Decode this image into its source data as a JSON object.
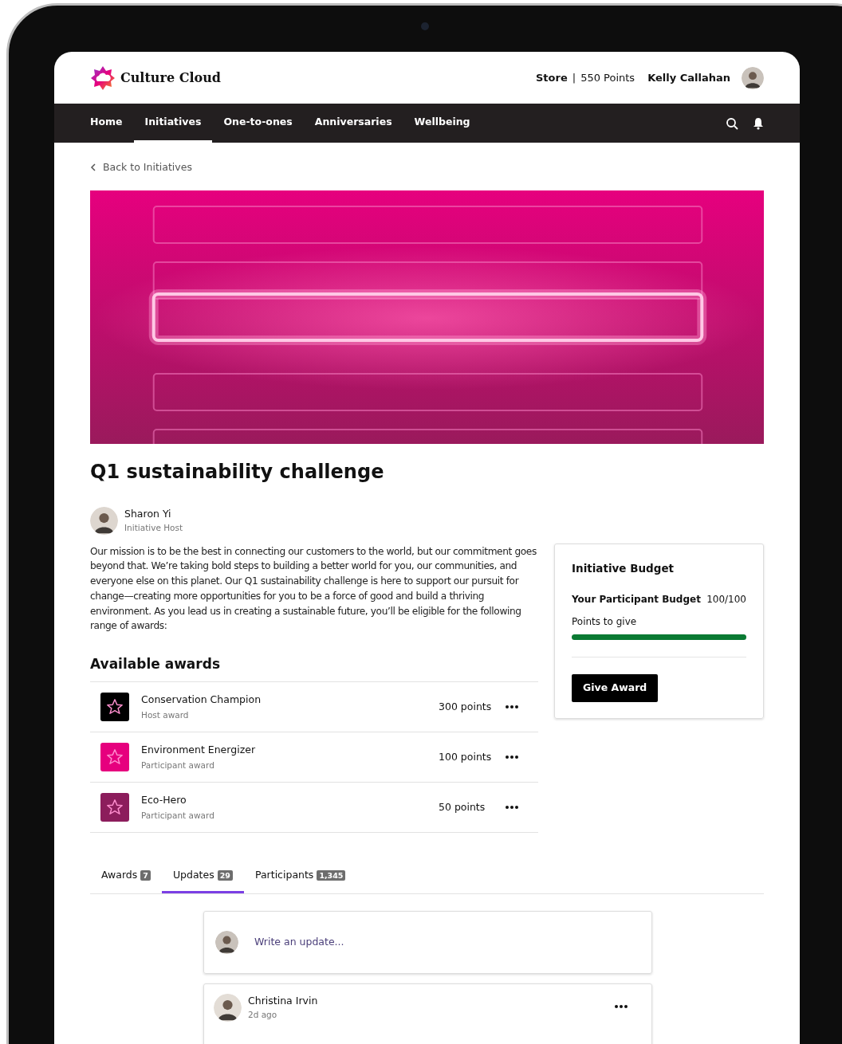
{
  "header": {
    "brand": "Culture Cloud",
    "store": "Store",
    "separator": "|",
    "points": "550 Points",
    "user": "Kelly Callahan"
  },
  "nav": [
    {
      "label": "Home",
      "selected": false
    },
    {
      "label": "Initiatives",
      "selected": true
    },
    {
      "label": "One-to-ones",
      "selected": false
    },
    {
      "label": "Anniversaries",
      "selected": false
    },
    {
      "label": "Wellbeing",
      "selected": false
    }
  ],
  "back_link": "Back to Initiatives",
  "title": "Q1 sustainability challenge",
  "host": {
    "name": "Sharon Yi",
    "role": "Initiative Host"
  },
  "description": "Our mission is to be the best in connecting our customers to the world, but our commitment goes beyond that. We’re taking bold steps to building a better world for you, our communities, and everyone else on this planet. Our Q1 sustainability challenge is here to support our pursuit for change—creating more opportunities for you to be a force of good and build a thriving environment. As you lead us in creating a sustainable future, you’ll be eligible for the following range of awards:",
  "awards_heading": "Available awards",
  "awards": [
    {
      "name": "Conservation Champion",
      "type": "Host award",
      "points": "300 points",
      "color": "#000000"
    },
    {
      "name": "Environment Energizer",
      "type": "Participant award",
      "points": "100 points",
      "color": "#e6007e"
    },
    {
      "name": "Eco-Hero",
      "type": "Participant award",
      "points": "50 points",
      "color": "#8c1d5c"
    }
  ],
  "budget": {
    "title": "Initiative Budget",
    "label": "Your Participant Budget",
    "value": "100/100",
    "points_label": "Points to give",
    "level": 1,
    "button": "Give Award"
  },
  "tabs": [
    {
      "label": "Awards",
      "count": "7",
      "selected": false
    },
    {
      "label": "Updates",
      "count": "29",
      "selected": true
    },
    {
      "label": "Participants",
      "count": "1,345",
      "selected": false
    }
  ],
  "composer": {
    "placeholder": "Write an update..."
  },
  "post": {
    "author": "Christina Irvin",
    "time": "2d ago"
  }
}
